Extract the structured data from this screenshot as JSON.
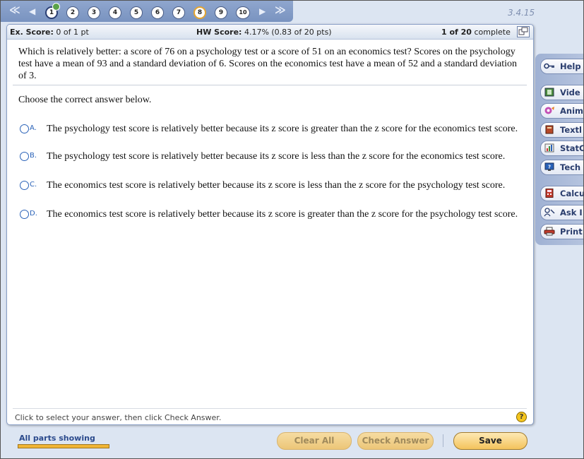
{
  "nav": {
    "first_arrow": "≪",
    "prev_arrow": "◀",
    "next_arrow": "▶",
    "last_arrow": "≫",
    "questions": [
      "1",
      "2",
      "3",
      "4",
      "5",
      "6",
      "7",
      "8",
      "9",
      "10"
    ],
    "current": "1",
    "flagged": "8",
    "version": "3.4.15"
  },
  "score": {
    "ex_label": "Ex. Score:",
    "ex_value": "0 of 1 pt",
    "hw_label": "HW Score:",
    "hw_value": "4.17% (0.83 of 20 pts)",
    "progress_bold": "1 of 20",
    "progress_rest": "complete"
  },
  "question": {
    "text": "Which is relatively better: a score of 76 on a psychology test or a score of 51 on an economics test? Scores on the psychology test have a mean of 93 and a standard deviation of 6. Scores on the economics test have a mean of 52 and a standard deviation of 3.",
    "prompt": "Choose the correct answer below.",
    "options": [
      {
        "letter": "A.",
        "text": "The psychology test score is relatively better because its z score is greater than the z score for the economics test score."
      },
      {
        "letter": "B.",
        "text": "The psychology test score is relatively better because its z score is less than the z score for the economics test score."
      },
      {
        "letter": "C.",
        "text": "The economics test score is relatively better because its z score is less than the z score for the psychology test score."
      },
      {
        "letter": "D.",
        "text": "The economics test score is relatively better because its z score is greater than the z score for the psychology test score."
      }
    ]
  },
  "footer": {
    "hint": "Click to select your answer, then click Check Answer.",
    "help_symbol": "?"
  },
  "sidebar": {
    "items": [
      {
        "label": "Help",
        "icon": "key-icon"
      },
      {
        "label": "Vide",
        "icon": "film-icon"
      },
      {
        "label": "Anim",
        "icon": "animation-icon"
      },
      {
        "label": "Textl",
        "icon": "book-icon"
      },
      {
        "label": "StatC",
        "icon": "statcrunch-icon"
      },
      {
        "label": "Tech",
        "icon": "tech-help-icon"
      },
      {
        "label": "Calcu",
        "icon": "calculator-icon"
      },
      {
        "label": "Ask I",
        "icon": "ask-instructor-icon"
      },
      {
        "label": "Print",
        "icon": "print-icon"
      }
    ]
  },
  "bottom": {
    "parts_label": "All parts showing",
    "clear_all": "Clear All",
    "check_answer": "Check Answer",
    "save": "Save"
  }
}
